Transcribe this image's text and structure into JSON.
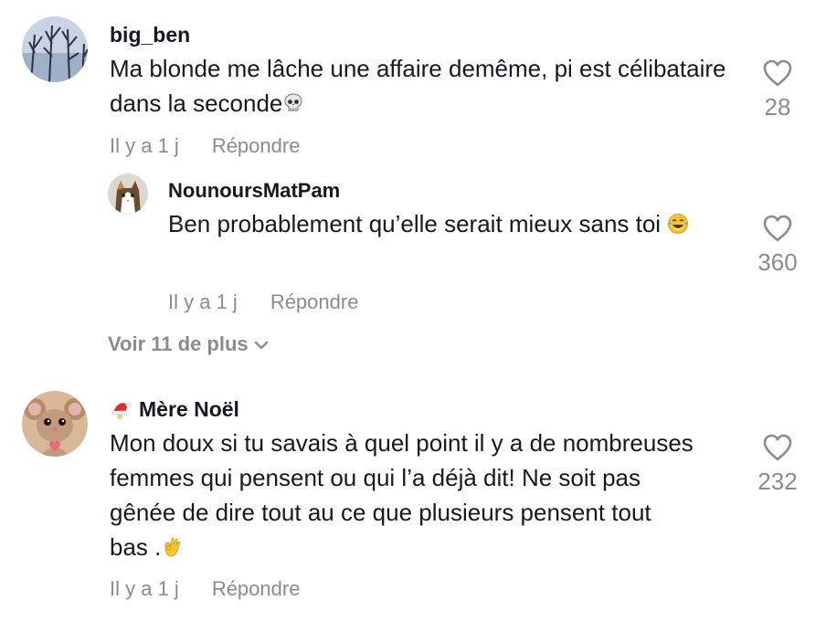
{
  "comments": [
    {
      "username": "big_ben",
      "text": "Ma blonde me lâche une affaire demême, pi est célibataire dans la seconde",
      "time": "Il y a 1 j",
      "reply_label": "Répondre",
      "likes": "28",
      "emoji": "skull-icon"
    },
    {
      "username": "NounoursMatPam",
      "text": "Ben probablement qu’elle serait mieux sans toi",
      "time": "Il y a 1 j",
      "reply_label": "Répondre",
      "likes": "360",
      "emoji": "tears-of-joy-icon"
    },
    {
      "username": "Mère Noël",
      "text": "Mon doux si tu savais à quel point il y a de nombreuses femmes qui pensent ou qui l’a déjà dit! Ne soit pas gênée de dire tout au ce que plusieurs pensent tout bas .",
      "time": "Il y a 1 j",
      "reply_label": "Répondre",
      "likes": "232",
      "emoji": "ok-hand-icon",
      "badge": "santa-hat-icon"
    }
  ],
  "view_more": {
    "label": "Voir 11 de plus"
  },
  "colors": {
    "text": "#161823",
    "secondary": "#8a8b91"
  }
}
